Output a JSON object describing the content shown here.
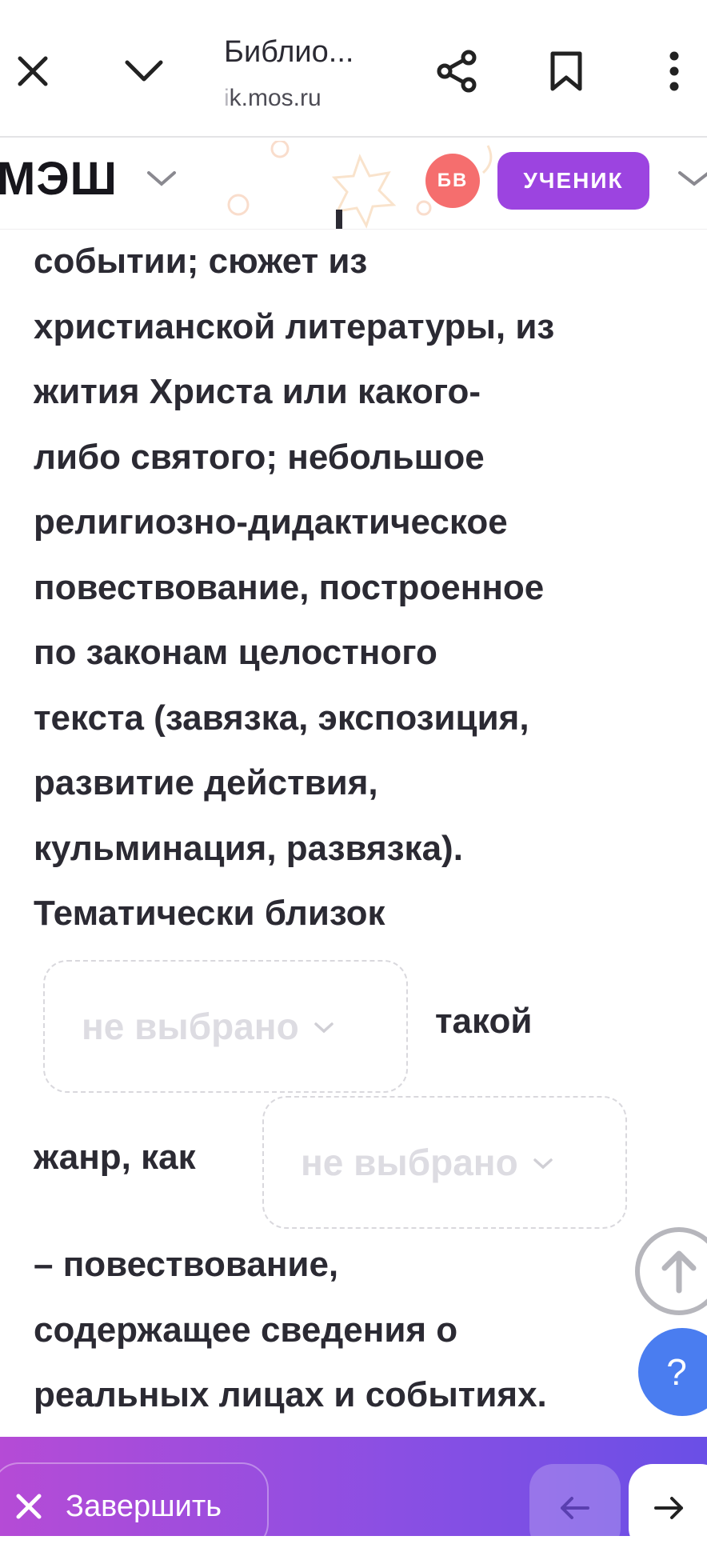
{
  "browser": {
    "page_title": "Библио...",
    "url_dim": "i",
    "url_main": "k.mos.ru"
  },
  "site_header": {
    "logo": "МЭШ",
    "avatar_initials": "БВ",
    "role_label": "УЧЕНИК"
  },
  "text": {
    "lines": [
      "событии; сюжет из",
      "христианской литературы, из",
      "жития Христа или какого-",
      "либо святого; небольшое",
      "религиозно-дидактическое",
      "повествование, построенное",
      "по законам целостного",
      "текста (завязка, экспозиция,",
      "развитие действия,",
      "кульминация, развязка).",
      "Тематически близок"
    ],
    "after_select_1": "такой",
    "before_select_2": "жанр, как",
    "tail_lines": [
      "– повествование,",
      "содержащее сведения о",
      "реальных лицах и событиях."
    ]
  },
  "selects": {
    "select_1": "не выбрано",
    "select_2": "не выбрано"
  },
  "help_label": "?",
  "bottom_bar": {
    "finish_label": "Завершить"
  },
  "colors": {
    "accent": "#9c44e0",
    "avatar": "#f56e6e",
    "help": "#4a7df0",
    "bar_start": "#b54bd6",
    "bar_end": "#6a4fe6"
  }
}
